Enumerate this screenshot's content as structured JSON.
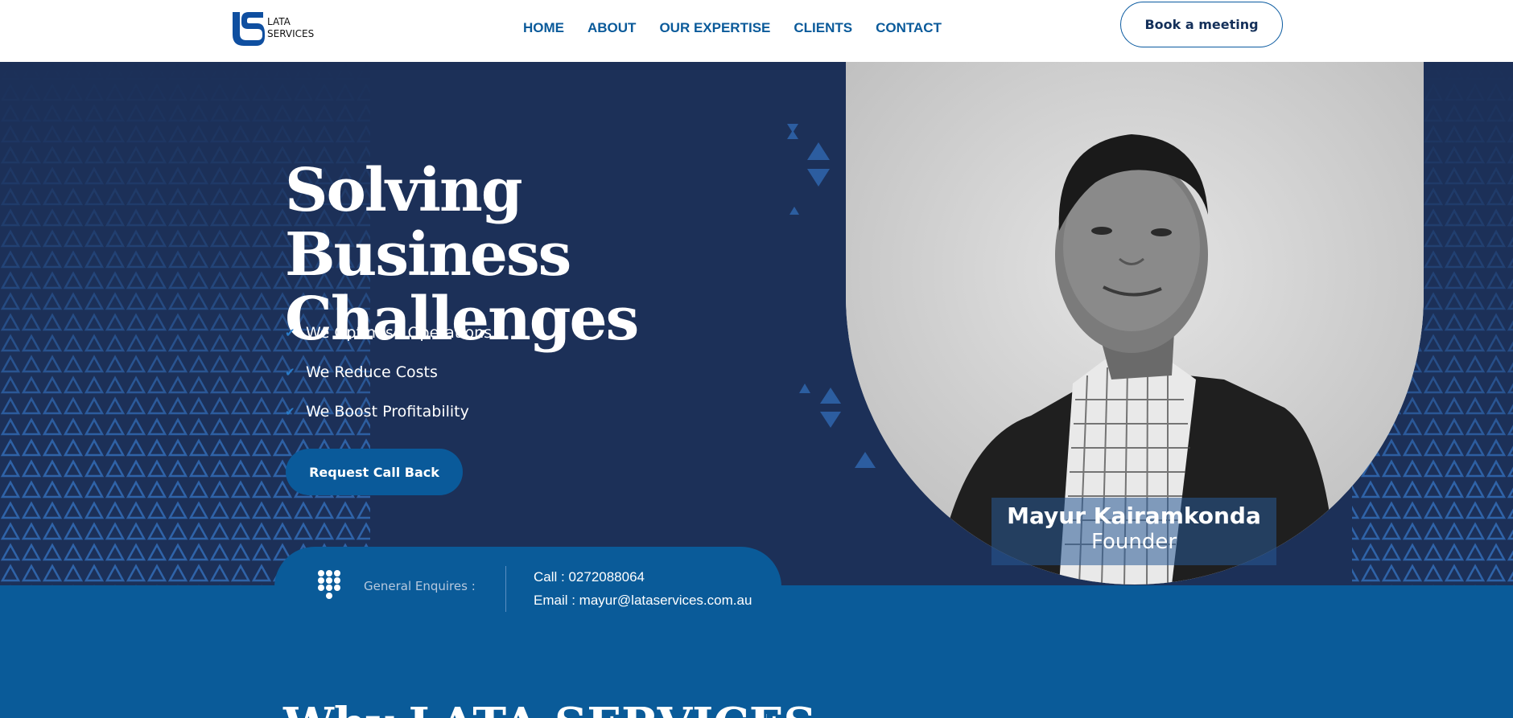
{
  "logo": {
    "line1": "LATA",
    "line2": "SERVICES"
  },
  "nav": {
    "items": [
      {
        "label": "HOME"
      },
      {
        "label": "ABOUT"
      },
      {
        "label": "OUR EXPERTISE"
      },
      {
        "label": "CLIENTS"
      },
      {
        "label": "CONTACT"
      }
    ]
  },
  "header": {
    "book_label": "Book a meeting"
  },
  "hero": {
    "title_line1": "Solving Business",
    "title_line2": "Challenges",
    "bullets": [
      {
        "label": "We Optimise Operations"
      },
      {
        "label": "We Reduce Costs"
      },
      {
        "label": "We Boost Profitability"
      }
    ],
    "cta_label": "Request Call Back",
    "person_name": "Mayur Kairamkonda",
    "person_role": "Founder"
  },
  "contact_card": {
    "label": "General Enquires :",
    "call": "Call : 0272088064",
    "email": "Email : mayur@lataservices.com.au"
  },
  "next_section": {
    "heading": "Why LATA SERVICES"
  },
  "colors": {
    "hero_bg": "#1c3058",
    "brand_blue": "#0a5a9a",
    "nav_text": "#0a5a9a",
    "section_blue": "#0a5b99"
  },
  "icons": {
    "check": "check-icon",
    "phone": "dialpad-icon"
  }
}
